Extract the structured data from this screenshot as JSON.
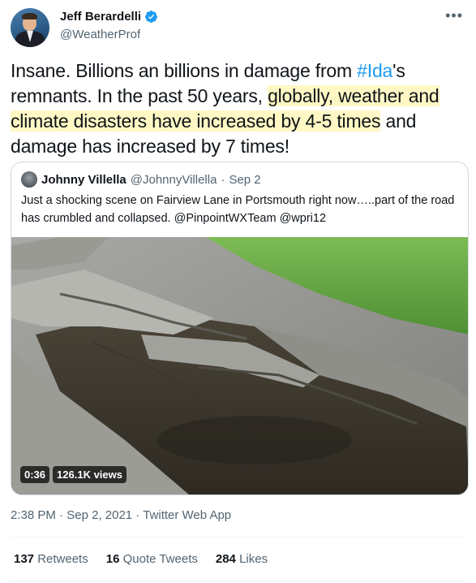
{
  "author": {
    "display_name": "Jeff Berardelli",
    "handle": "@WeatherProf",
    "verified": true
  },
  "more_icon": "more-horizontal-icon",
  "tweet": {
    "text_part1": "Insane. Billions an billions in damage from ",
    "hashtag": "#Ida",
    "text_part2": "'s remnants. In the past 50 years, ",
    "highlight": "globally, weather and climate disasters have increased by 4-5 times",
    "text_part3": " and damage has increased by 7 times!"
  },
  "quoted": {
    "display_name": "Johnny Villella",
    "handle": "@JohnnyVillella",
    "separator": " · ",
    "date": "Sep 2",
    "text": "Just a shocking scene on Fairview Lane in Portsmouth right now…..part of the road has crumbled and collapsed. @PinpointWXTeam @wpri12",
    "video_duration": "0:36",
    "video_views": "126.1K views"
  },
  "meta": {
    "time": "2:38 PM",
    "separator": " · ",
    "date": "Sep 2, 2021",
    "source": "Twitter Web App"
  },
  "stats": {
    "retweets_count": "137",
    "retweets_label": " Retweets",
    "quotes_count": "16",
    "quotes_label": " Quote Tweets",
    "likes_count": "284",
    "likes_label": " Likes"
  },
  "colors": {
    "link": "#1d9bf0",
    "highlight": "#fff8c5",
    "secondary_text": "#536471",
    "verified": "#1d9bf0"
  }
}
